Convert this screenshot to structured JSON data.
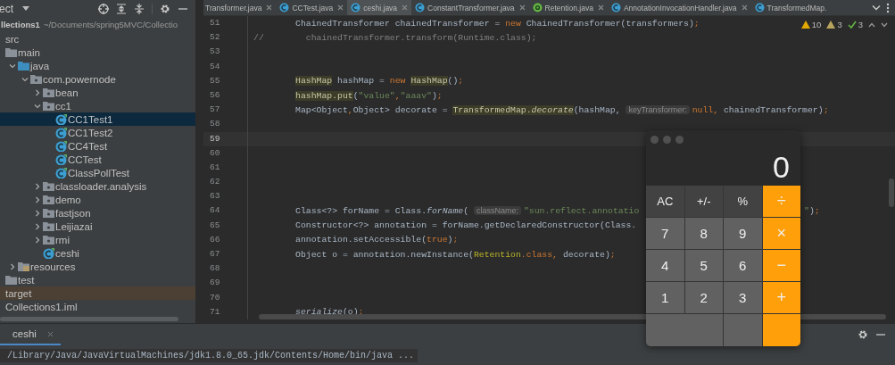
{
  "project_panel": {
    "title": "ect",
    "root": {
      "name": "llections1",
      "path": "~/Documents/spring5MVC/Collectio"
    },
    "tree": [
      {
        "name": "src",
        "selected": false,
        "children": [
          {
            "name": "main",
            "kind": "folder",
            "selected": false,
            "children": [
              {
                "name": "java",
                "kind": "source-folder",
                "expanded": true,
                "selected": false,
                "children": [
                  {
                    "name": "com.powernode",
                    "kind": "package",
                    "expanded": true,
                    "selected": false,
                    "children": [
                      {
                        "name": "bean",
                        "kind": "package",
                        "expanded": false,
                        "selected": false
                      },
                      {
                        "name": "cc1",
                        "kind": "package",
                        "expanded": true,
                        "selected": false,
                        "children": [
                          {
                            "name": "CC1Test1",
                            "kind": "class",
                            "selected": true
                          },
                          {
                            "name": "CC1Test2",
                            "kind": "class",
                            "selected": false
                          },
                          {
                            "name": "CC4Test",
                            "kind": "class",
                            "selected": false
                          },
                          {
                            "name": "CCTest",
                            "kind": "class",
                            "selected": false
                          },
                          {
                            "name": "ClassPollTest",
                            "kind": "class",
                            "selected": false
                          }
                        ]
                      },
                      {
                        "name": "classloader.analysis",
                        "kind": "package",
                        "expanded": false,
                        "selected": false
                      },
                      {
                        "name": "demo",
                        "kind": "package",
                        "expanded": false,
                        "selected": false
                      },
                      {
                        "name": "fastjson",
                        "kind": "package",
                        "expanded": false,
                        "selected": false
                      },
                      {
                        "name": "Leijiazai",
                        "kind": "package",
                        "expanded": false,
                        "selected": false
                      },
                      {
                        "name": "rmi",
                        "kind": "package",
                        "expanded": false,
                        "selected": false
                      },
                      {
                        "name": "ceshi",
                        "kind": "class",
                        "selected": false
                      }
                    ]
                  }
                ]
              },
              {
                "name": "resources",
                "kind": "resources",
                "expanded": false,
                "selected": false
              }
            ]
          },
          {
            "name": "test",
            "kind": "folder",
            "selected": false
          }
        ]
      },
      {
        "name": "target",
        "excluded": true,
        "selected": false
      },
      {
        "name": "Collections1.iml",
        "selected": false
      }
    ]
  },
  "editor_tabs": [
    {
      "label": "Transformer.java",
      "kind": "none",
      "closable": true,
      "selected": false
    },
    {
      "label": "CCTest.java",
      "kind": "class",
      "closable": true,
      "selected": false
    },
    {
      "label": "ceshi.java",
      "kind": "class",
      "closable": true,
      "selected": true
    },
    {
      "label": "ConstantTransformer.java",
      "kind": "class",
      "closable": true,
      "selected": false
    },
    {
      "label": "Retention.java",
      "kind": "annotation",
      "closable": true,
      "selected": false
    },
    {
      "label": "AnnotationInvocationHandler.java",
      "kind": "class",
      "closable": true,
      "selected": false
    },
    {
      "label": "TransformedMap.",
      "kind": "class",
      "closable": false,
      "selected": false
    }
  ],
  "inspections": {
    "warnings": "10",
    "weak_warnings": "3",
    "passed": "3"
  },
  "editor": {
    "lines": [
      {
        "number": "51",
        "current": false,
        "indented": true,
        "segments": [
          {
            "text": "ChainedTransformer chainedTransformer = ",
            "kind": "plain"
          },
          {
            "text": "new",
            "kind": "kw"
          },
          {
            "text": " ChainedTransformer(transformers)",
            "kind": "plain"
          },
          {
            "text": ";",
            "kind": "kw"
          }
        ]
      },
      {
        "number": "52",
        "current": false,
        "indented": false,
        "segments": [
          {
            "text": "//        chainedTransformer.transform(Runtime.class);",
            "kind": "comment"
          }
        ]
      },
      {
        "number": "53",
        "current": false
      },
      {
        "number": "54",
        "current": false
      },
      {
        "number": "55",
        "current": false,
        "indented": true,
        "segments": [
          {
            "text": "HashMap",
            "kind": "hl"
          },
          {
            "text": " hashMap = ",
            "kind": "plain"
          },
          {
            "text": "new ",
            "kind": "kw"
          },
          {
            "text": "HashMap",
            "kind": "hl"
          },
          {
            "text": "()",
            "kind": "plain"
          },
          {
            "text": ";",
            "kind": "kw"
          }
        ]
      },
      {
        "number": "56",
        "current": false,
        "indented": true,
        "segments": [
          {
            "text": "hashMap.put",
            "kind": "hl"
          },
          {
            "text": "(",
            "kind": "plain"
          },
          {
            "text": "\"value\"",
            "kind": "str"
          },
          {
            "text": ",",
            "kind": "kw"
          },
          {
            "text": "\"aaav\"",
            "kind": "str"
          },
          {
            "text": ")",
            "kind": "plain"
          },
          {
            "text": ";",
            "kind": "kw"
          }
        ]
      },
      {
        "number": "57",
        "current": false,
        "indented": true,
        "segments": [
          {
            "text": "Map<Object",
            "kind": "plain"
          },
          {
            "text": ",",
            "kind": "kw"
          },
          {
            "text": "Object> decorate = ",
            "kind": "plain"
          },
          {
            "text": "TransformedMap.",
            "kind": "hl"
          },
          {
            "text": "decorate",
            "kind": "hl-italic"
          },
          {
            "text": "(hashMap, ",
            "kind": "plain"
          },
          {
            "text": "keyTransformer:",
            "kind": "hint"
          },
          {
            "text": "null,",
            "kind": "kw"
          },
          {
            "text": " chainedTransformer)",
            "kind": "plain"
          },
          {
            "text": ";",
            "kind": "kw"
          }
        ]
      },
      {
        "number": "58",
        "current": false
      },
      {
        "number": "59",
        "current": true
      },
      {
        "number": "60",
        "current": false
      },
      {
        "number": "61",
        "current": false
      },
      {
        "number": "62",
        "current": false
      },
      {
        "number": "63",
        "current": false
      },
      {
        "number": "64",
        "current": false,
        "indented": true,
        "segments": [
          {
            "text": "Class<?> forName = Class.",
            "kind": "plain"
          },
          {
            "text": "forName",
            "kind": "italic"
          },
          {
            "text": "( ",
            "kind": "plain"
          },
          {
            "text": "className:",
            "kind": "hint"
          },
          {
            "text": "\"sun.reflect.annotatio",
            "kind": "str"
          }
        ],
        "tail": [
          {
            "text": "\"",
            "kind": "str"
          },
          {
            "text": ")",
            "kind": "plain"
          },
          {
            "text": ";",
            "kind": "kw"
          }
        ]
      },
      {
        "number": "65",
        "current": false,
        "indented": true,
        "segments": [
          {
            "text": "Constructor<?> annotation = forName.getDeclaredConstructor(Class.",
            "kind": "plain"
          }
        ]
      },
      {
        "number": "66",
        "current": false,
        "indented": true,
        "segments": [
          {
            "text": "annotation.setAccessible(",
            "kind": "plain"
          },
          {
            "text": "true",
            "kind": "kw"
          },
          {
            "text": ")",
            "kind": "plain"
          },
          {
            "text": ";",
            "kind": "kw"
          }
        ]
      },
      {
        "number": "67",
        "current": false,
        "indented": true,
        "segments": [
          {
            "text": "Object o = annotation.newInstance(",
            "kind": "plain"
          },
          {
            "text": "Retention",
            "kind": "anno"
          },
          {
            "text": ".class, ",
            "kind": "kw"
          },
          {
            "text": "decorate)",
            "kind": "plain"
          },
          {
            "text": ";",
            "kind": "kw"
          }
        ]
      },
      {
        "number": "68",
        "current": false
      },
      {
        "number": "69",
        "current": false
      },
      {
        "number": "70",
        "current": false
      },
      {
        "number": "71",
        "current": false,
        "indented": true,
        "segments": [
          {
            "text": "serialize",
            "kind": "italic"
          },
          {
            "text": "(o)",
            "kind": "plain"
          },
          {
            "text": ";",
            "kind": "kw"
          }
        ]
      }
    ]
  },
  "calculator": {
    "display": "0",
    "keys": [
      {
        "label": "AC",
        "kind": "func"
      },
      {
        "label": "+/-",
        "kind": "func"
      },
      {
        "label": "%",
        "kind": "func"
      },
      {
        "label": "÷",
        "kind": "op"
      },
      {
        "label": "7",
        "kind": "digit"
      },
      {
        "label": "8",
        "kind": "digit"
      },
      {
        "label": "9",
        "kind": "digit"
      },
      {
        "label": "×",
        "kind": "op"
      },
      {
        "label": "4",
        "kind": "digit"
      },
      {
        "label": "5",
        "kind": "digit"
      },
      {
        "label": "6",
        "kind": "digit"
      },
      {
        "label": "−",
        "kind": "op"
      },
      {
        "label": "1",
        "kind": "digit"
      },
      {
        "label": "2",
        "kind": "digit"
      },
      {
        "label": "3",
        "kind": "digit"
      },
      {
        "label": "+",
        "kind": "op"
      },
      {
        "kind": "wide-digit"
      },
      {
        "kind": "digit"
      },
      {
        "kind": "op"
      }
    ]
  },
  "run_panel": {
    "tab": "ceshi",
    "command": "/Library/Java/JavaVirtualMachines/jdk1.8.0_65.jdk/Contents/Home/bin/java ..."
  }
}
